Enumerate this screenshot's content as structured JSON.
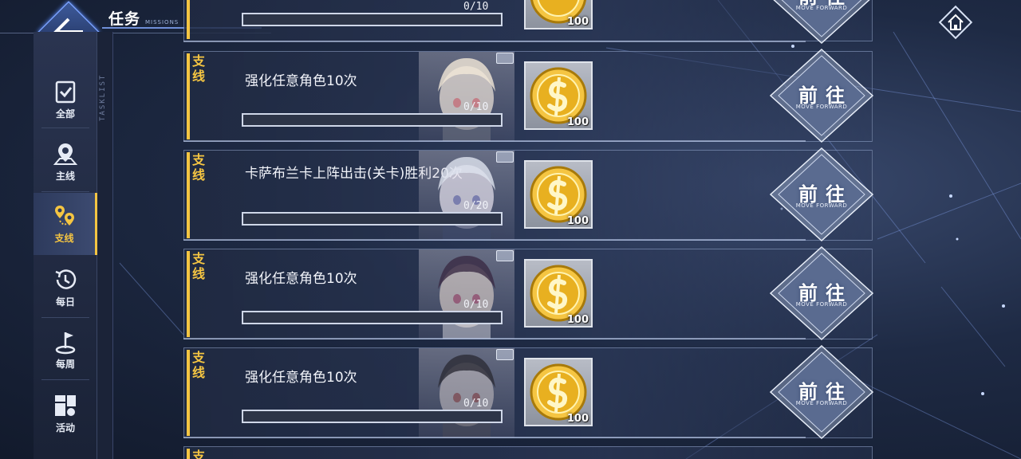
{
  "header": {
    "title": "任务",
    "subtitle": "MISSIONS",
    "tasklist_label": "TASKLIST"
  },
  "sidebar": {
    "items": [
      {
        "label": "全部",
        "icon": "checklist-icon",
        "active": false
      },
      {
        "label": "主线",
        "icon": "map-pin-icon",
        "active": false
      },
      {
        "label": "支线",
        "icon": "branch-pins-icon",
        "active": true
      },
      {
        "label": "每日",
        "icon": "clock-history-icon",
        "active": false
      },
      {
        "label": "每周",
        "icon": "flag-icon",
        "active": false
      },
      {
        "label": "活动",
        "icon": "activity-blocks-icon",
        "active": false
      }
    ]
  },
  "top_partial": {
    "progress": "0/10",
    "reward_amount": "100",
    "go_label": "前往",
    "go_sub": "MOVE FORWARD"
  },
  "missions": [
    {
      "tag": "支线",
      "title": "强化任意角色10次",
      "progress": "0/10",
      "fraction": 0,
      "reward_amount": "100",
      "go_label": "前往",
      "go_sub": "MOVE FORWARD"
    },
    {
      "tag": "支线",
      "title": "卡萨布兰卡上阵出击(关卡)胜利20次",
      "progress": "0/20",
      "fraction": 0,
      "reward_amount": "100",
      "go_label": "前往",
      "go_sub": "MOVE FORWARD"
    },
    {
      "tag": "支线",
      "title": "强化任意角色10次",
      "progress": "0/10",
      "fraction": 0,
      "reward_amount": "100",
      "go_label": "前往",
      "go_sub": "MOVE FORWARD"
    },
    {
      "tag": "支线",
      "title": "强化任意角色10次",
      "progress": "0/10",
      "fraction": 0,
      "reward_amount": "100",
      "go_label": "前往",
      "go_sub": "MOVE FORWARD"
    }
  ],
  "bottom_partial": {
    "tag": "支"
  },
  "colors": {
    "accent": "#f5c542",
    "frame": "#7aa2ff",
    "background": "#1e2a44"
  }
}
